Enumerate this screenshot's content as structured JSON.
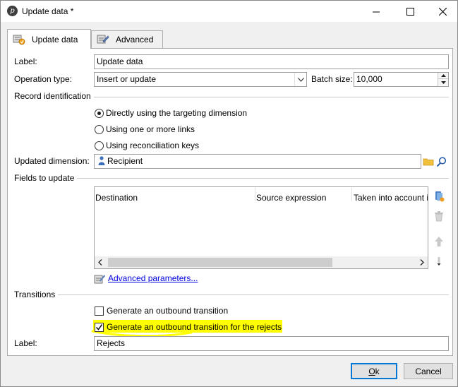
{
  "window": {
    "title": "Update data *",
    "app_icon": "p-logo-icon"
  },
  "tabs": [
    {
      "label": "Update data",
      "icon": "update-data-icon",
      "active": true
    },
    {
      "label": "Advanced",
      "icon": "advanced-icon",
      "active": false
    }
  ],
  "form": {
    "label_caption": "Label:",
    "label_value": "Update data",
    "operation_type_caption": "Operation type:",
    "operation_type_value": "Insert or update",
    "batch_size_caption": "Batch size:",
    "batch_size_value": "10,000"
  },
  "record_identification": {
    "section_title": "Record identification",
    "options": [
      {
        "label": "Directly using the targeting dimension",
        "selected": true
      },
      {
        "label": "Using one or more links",
        "selected": false
      },
      {
        "label": "Using reconciliation keys",
        "selected": false
      }
    ],
    "updated_dimension_caption": "Updated dimension:",
    "updated_dimension_value": "Recipient"
  },
  "fields_to_update": {
    "section_title": "Fields to update",
    "columns": [
      "Destination",
      "Source expression",
      "Taken into account i"
    ],
    "rows": [],
    "advanced_link": "Advanced parameters..."
  },
  "transitions": {
    "section_title": "Transitions",
    "generate_outbound_label": "Generate an outbound transition",
    "generate_outbound_checked": false,
    "generate_rejects_label": "Generate an outbound transition for the rejects",
    "generate_rejects_checked": true,
    "label_caption": "Label:",
    "label_value": "Rejects"
  },
  "buttons": {
    "ok_letter": "O",
    "ok_rest": "k",
    "cancel": "Cancel"
  },
  "colors": {
    "highlight": "#ffff00",
    "link": "#0000e0",
    "default_button_border": "#0078d7"
  }
}
